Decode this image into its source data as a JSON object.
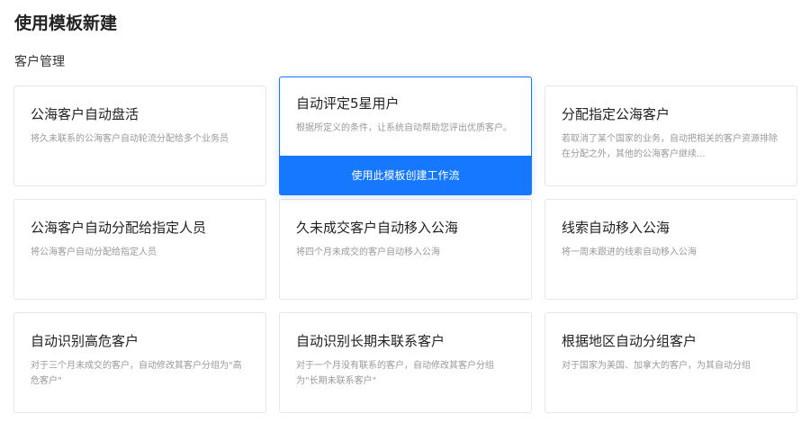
{
  "page": {
    "title": "使用模板新建",
    "section_label": "客户管理"
  },
  "templates": [
    {
      "title": "公海客户自动盘活",
      "desc": "将久未联系的公海客户自动轮流分配给多个业务员"
    },
    {
      "title": "自动评定5星用户",
      "desc": "根据所定义的条件，让系统自动帮助您评出优质客户。",
      "button_label": "使用此模板创建工作流"
    },
    {
      "title": "分配指定公海客户",
      "desc": "若取消了某个国家的业务，自动把相关的客户资源排除在分配之外，其他的公海客户继续..."
    },
    {
      "title": "公海客户自动分配给指定人员",
      "desc": "将公海客户自动分配给指定人员"
    },
    {
      "title": "久未成交客户自动移入公海",
      "desc": "将四个月未成交的客户自动移入公海"
    },
    {
      "title": "线索自动移入公海",
      "desc": "将一周未跟进的线索自动移入公海"
    },
    {
      "title": "自动识别高危客户",
      "desc": "对于三个月未成交的客户，自动修改其客户分组为\"高危客户\""
    },
    {
      "title": "自动识别长期未联系客户",
      "desc": "对于一个月没有联系的客户，自动修改其客户分组为\"长期未联系客户\""
    },
    {
      "title": "根据地区自动分组客户",
      "desc": "对于国家为美国、加拿大的客户，为其自动分组"
    }
  ],
  "colors": {
    "accent": "#1677ff",
    "card_border": "#e6e6e6",
    "desc_text": "#999999"
  }
}
